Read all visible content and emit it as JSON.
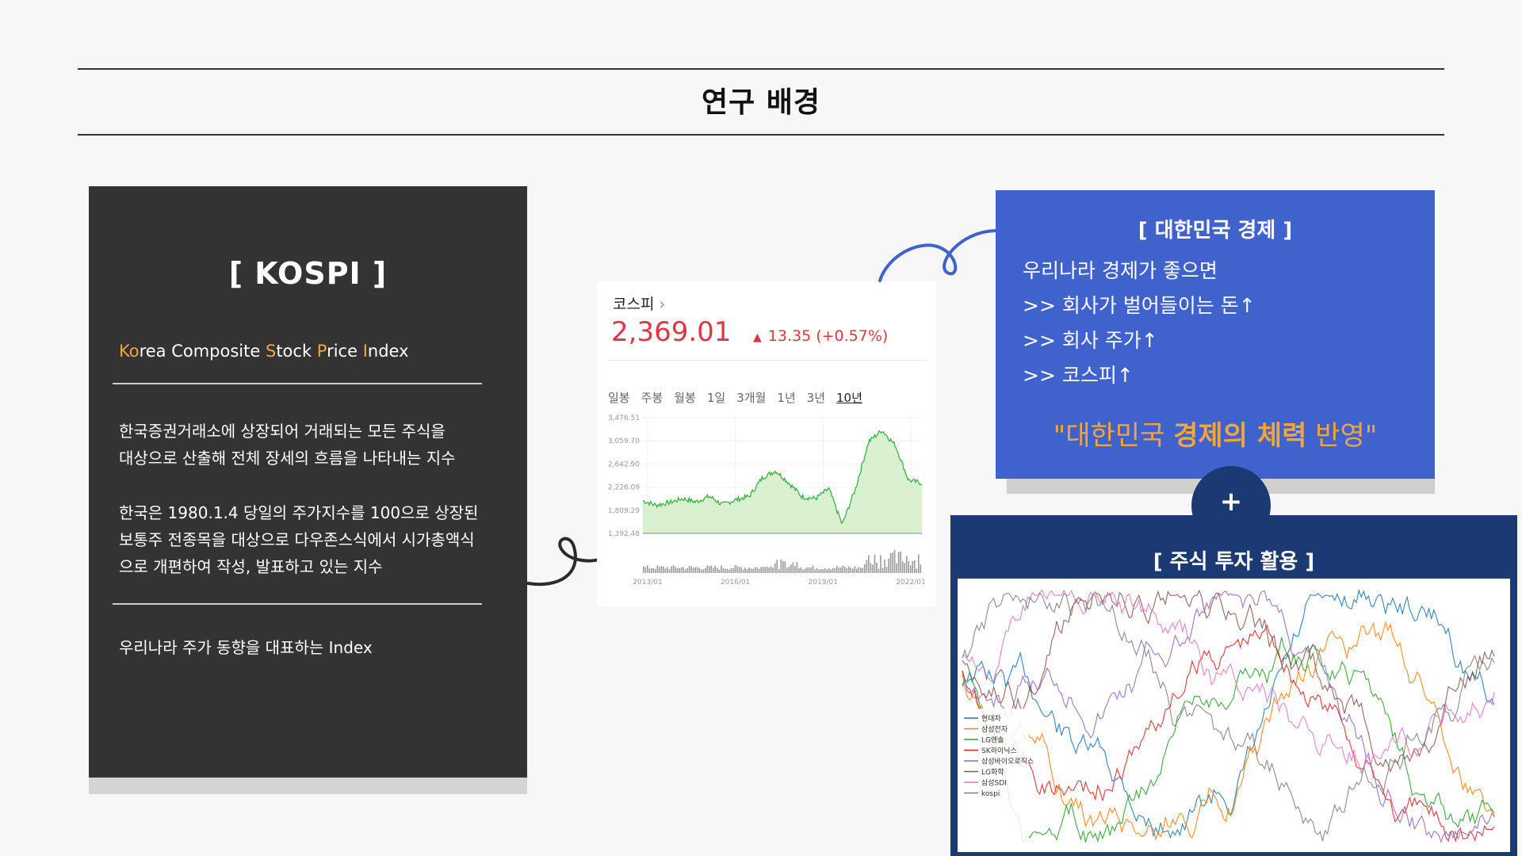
{
  "header": {
    "title": "연구 배경"
  },
  "kospi": {
    "title": "[  KOSPI  ]",
    "fullname_parts": [
      "Ko",
      "rea Composite ",
      "S",
      "tock ",
      "P",
      "rice ",
      "I",
      "ndex"
    ],
    "para1_line1": "한국증권거래소에 상장되어 거래되는 모든 주식을",
    "para1_line2": "대상으로 산출해 전체 장세의 흐름을 나타내는 지수",
    "para2_line1": "한국은 1980.1.4 당일의 주가지수를 100으로 상장된",
    "para2_line2": "보통주 전종목을 대상으로 다우존스식에서 시가총액식",
    "para2_line3": "으로 개편하여 작성, 발표하고 있는 지수",
    "summary": "우리나라 주가 동향을 대표하는 Index"
  },
  "widget": {
    "name": "코스피",
    "chevron": "›",
    "price": "2,369.01",
    "arrow": "▲",
    "change": "13.35 (+0.57%)",
    "tabs": [
      "일봉",
      "주봉",
      "월봉",
      "1일",
      "3개월",
      "1년",
      "3년",
      "10년"
    ],
    "active_tab": "10년",
    "accent_color": "#e0363d",
    "line_color": "#3cb043"
  },
  "economy": {
    "title": "[  대한민국 경제  ]",
    "line1": "우리나라 경제가 좋으면",
    "line2": ">> 회사가 벌어들이는 돈↑",
    "line3": ">> 회사 주가↑",
    "line4": ">> 코스피↑",
    "quote_parts": [
      "\"대한민국 ",
      "경제의 체력",
      " 반영\""
    ],
    "bg_color": "#3f62cc",
    "accent_color": "#f4a53a"
  },
  "plus": {
    "symbol": "+"
  },
  "investment": {
    "title": "[  주식 투자 활용  ]",
    "bg_color": "#1b3a73"
  },
  "chart_data": [
    {
      "type": "area",
      "x_ticks": [
        "2013/01",
        "2016/01",
        "2019/01",
        "2022/01"
      ],
      "y_ticks": [
        "3,476.51",
        "3,059.70",
        "2,642.90",
        "2,226.09",
        "1,809.29",
        "1,392.48"
      ],
      "ylim": [
        1392.48,
        3476.51
      ],
      "x": [
        "2013/01",
        "2013/07",
        "2014/01",
        "2014/07",
        "2015/01",
        "2015/07",
        "2016/01",
        "2016/07",
        "2017/01",
        "2017/07",
        "2018/01",
        "2018/07",
        "2019/01",
        "2019/07",
        "2020/01",
        "2020/03",
        "2020/07",
        "2021/01",
        "2021/07",
        "2022/01",
        "2022/07",
        "2022/10"
      ],
      "values": [
        1980,
        1900,
        1950,
        2020,
        1960,
        2060,
        1910,
        2000,
        2060,
        2400,
        2520,
        2300,
        2050,
        2020,
        2200,
        1550,
        2200,
        3050,
        3250,
        2980,
        2350,
        2300
      ],
      "volume_shown": true
    },
    {
      "type": "line",
      "legend": [
        "현대차",
        "삼성전자",
        "LG엔솔",
        "SK하이닉스",
        "삼성바이오로직스",
        "LG화학",
        "삼성SDI",
        "kospi"
      ],
      "legend_position": "bottom-left",
      "series_colors": [
        "#1f77b4",
        "#ff7f0e",
        "#2ca02c",
        "#d62728",
        "#9467bd",
        "#8c564b",
        "#e377c2",
        "#7f7f7f"
      ]
    }
  ]
}
